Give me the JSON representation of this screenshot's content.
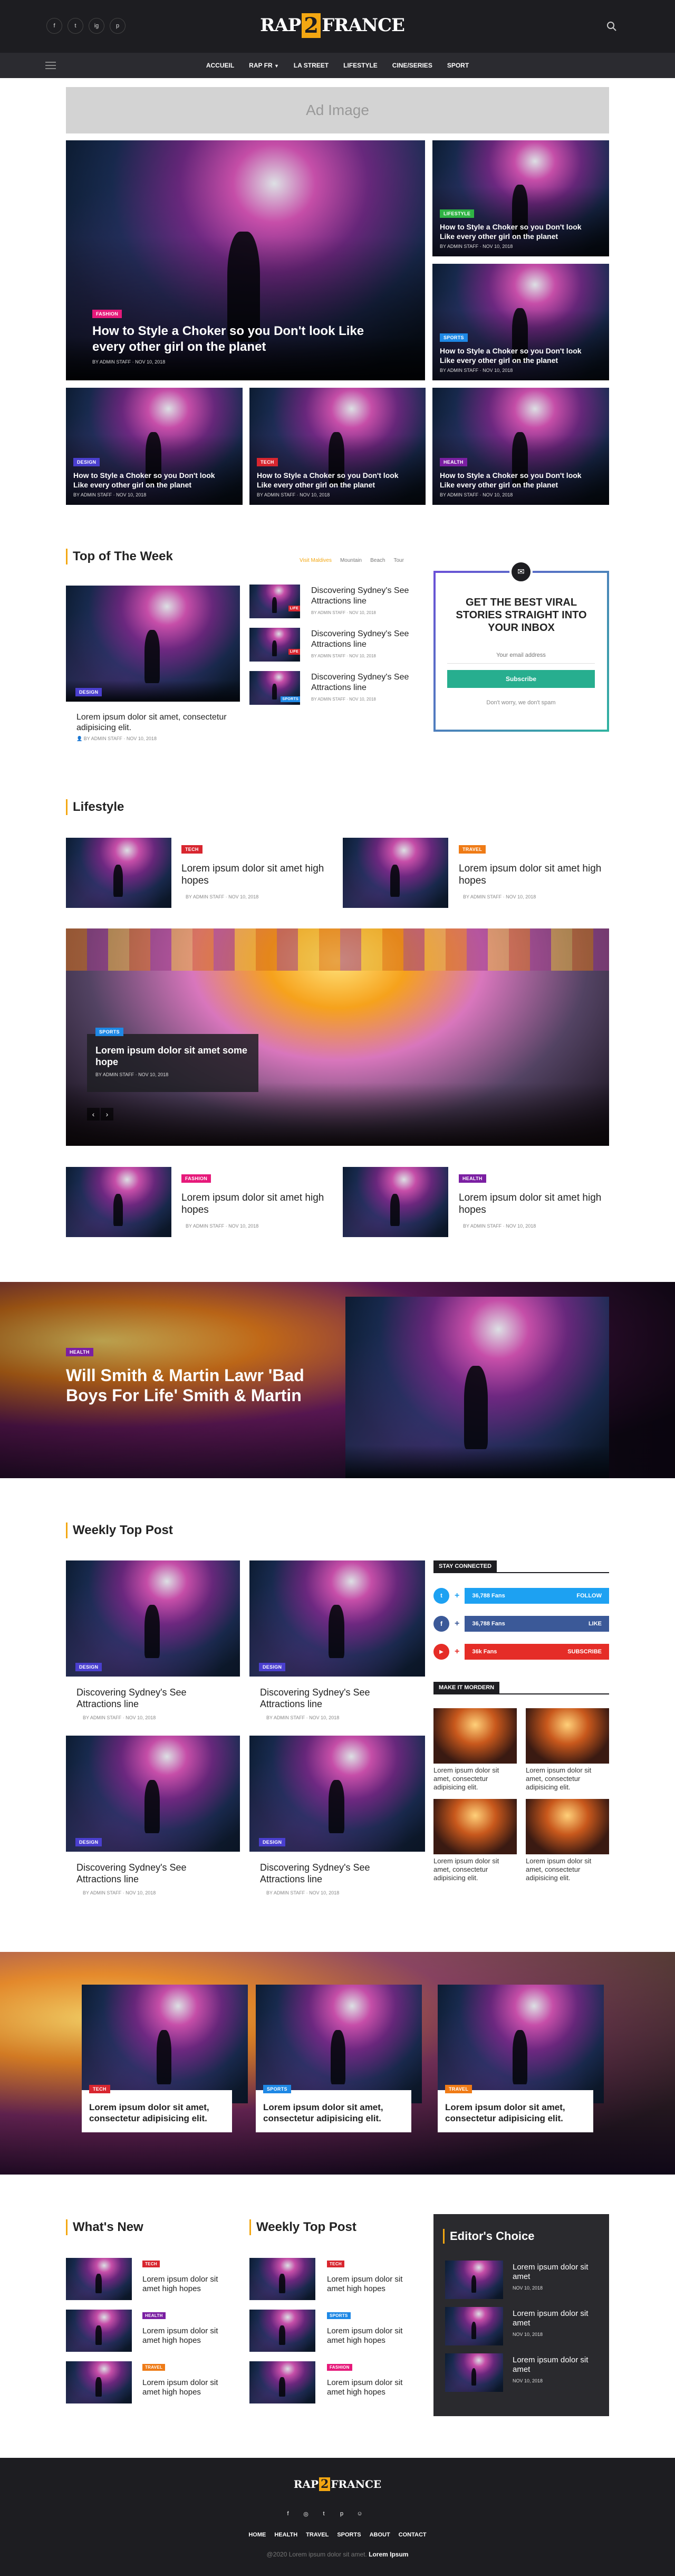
{
  "header": {
    "social": [
      "f",
      "t",
      "ig",
      "p"
    ],
    "logo_top": "RAP",
    "logo_num": "2",
    "logo_bottom": "FRANCE",
    "search_icon": "search-icon"
  },
  "nav": {
    "items": [
      "ACCUEIL",
      "RAP FR",
      "LA STREET",
      "LIFESTYLE",
      "CINE/SERIES",
      "SPORT"
    ],
    "dropdown_item": "RAP FR"
  },
  "ad": {
    "label": "Ad Image"
  },
  "hero": {
    "main": {
      "tag": "FASHION",
      "title": "How to Style a Choker so you Don't look Like every other girl on the planet",
      "meta": "BY ADMIN STAFF · NOV 10, 2018"
    },
    "side": [
      {
        "tag": "LIFESTYLE",
        "title": "How to Style a Choker so you Don't look Like every other girl on the planet",
        "meta": "BY ADMIN STAFF · NOV 10, 2018"
      },
      {
        "tag": "SPORTS",
        "title": "How to Style a Choker so you Don't look Like every other girl on the planet",
        "meta": "BY ADMIN STAFF · NOV 10, 2018"
      }
    ],
    "row": [
      {
        "tag": "DESIGN",
        "title": "How to Style a Choker so you Don't look Like every other girl on the planet",
        "meta": "BY ADMIN STAFF · NOV 10, 2018"
      },
      {
        "tag": "TECH",
        "title": "How to Style a Choker so you Don't look Like every other girl on the planet",
        "meta": "BY ADMIN STAFF · NOV 10, 2018"
      },
      {
        "tag": "HEALTH",
        "title": "How to Style a Choker so you Don't look Like every other girl on the planet",
        "meta": "BY ADMIN STAFF · NOV 10, 2018"
      }
    ]
  },
  "top_week": {
    "title": "Top of The Week",
    "filters": [
      "Visit Maldives",
      "Mountain",
      "Beach",
      "Tour"
    ],
    "main": {
      "tag": "DESIGN",
      "title": "Lorem ipsum dolor sit amet, consectetur adipisicing elit.",
      "meta": "BY ADMIN STAFF · NOV 10, 2018"
    },
    "list": [
      {
        "tag": "LIFE",
        "title": "Discovering Sydney's See Attractions line",
        "meta": "BY ADMIN STAFF · NOV 10, 2018"
      },
      {
        "tag": "LIFE",
        "title": "Discovering Sydney's See Attractions line",
        "meta": "BY ADMIN STAFF · NOV 10, 2018"
      },
      {
        "tag": "SPORTS",
        "title": "Discovering Sydney's See Attractions line",
        "meta": "BY ADMIN STAFF · NOV 10, 2018"
      }
    ]
  },
  "newsletter": {
    "title": "GET THE BEST VIRAL STORIES STRAIGHT INTO YOUR INBOX",
    "placeholder": "Your email address",
    "button": "Subscribe",
    "note": "Don't worry, we don't spam"
  },
  "lifestyle": {
    "title": "Lifestyle",
    "row1": [
      {
        "tag": "TECH",
        "title": "Lorem ipsum dolor sit amet high hopes",
        "meta": "BY ADMIN STAFF · NOV 10, 2018"
      },
      {
        "tag": "TRAVEL",
        "title": "Lorem ipsum dolor sit amet high hopes",
        "meta": "BY ADMIN STAFF · NOV 10, 2018"
      }
    ],
    "slider": {
      "tag": "SPORTS",
      "title": "Lorem ipsum dolor sit amet some hope",
      "meta": "BY ADMIN STAFF · NOV 10, 2018",
      "prev": "‹",
      "next": "›"
    },
    "row2": [
      {
        "tag": "FASHION",
        "title": "Lorem ipsum dolor sit amet high hopes",
        "meta": "BY ADMIN STAFF · NOV 10, 2018"
      },
      {
        "tag": "HEALTH",
        "title": "Lorem ipsum dolor sit amet high hopes",
        "meta": "BY ADMIN STAFF · NOV 10, 2018"
      }
    ]
  },
  "banner": {
    "tag": "HEALTH",
    "title": "Will Smith & Martin Lawr 'Bad Boys For Life' Smith & Martin"
  },
  "weekly": {
    "title": "Weekly Top Post",
    "items": [
      {
        "tag": "DESIGN",
        "title": "Discovering Sydney's See Attractions line",
        "meta": "BY ADMIN STAFF · NOV 10, 2018"
      },
      {
        "tag": "DESIGN",
        "title": "Discovering Sydney's See Attractions line",
        "meta": "BY ADMIN STAFF · NOV 10, 2018"
      },
      {
        "tag": "DESIGN",
        "title": "Discovering Sydney's See Attractions line",
        "meta": "BY ADMIN STAFF · NOV 10, 2018"
      },
      {
        "tag": "DESIGN",
        "title": "Discovering Sydney's See Attractions line",
        "meta": "BY ADMIN STAFF · NOV 10, 2018"
      }
    ]
  },
  "stay": {
    "title": "STAY CONNECTED",
    "rows": [
      {
        "count": "36,788 Fans",
        "action": "FOLLOW",
        "icon": "twitter-icon"
      },
      {
        "count": "36,788 Fans",
        "action": "LIKE",
        "icon": "facebook-icon"
      },
      {
        "count": "36k Fans",
        "action": "SUBSCRIBE",
        "icon": "youtube-icon"
      }
    ]
  },
  "modern": {
    "title": "MAKE IT MORDERN",
    "items": [
      "Lorem ipsum dolor sit amet, consectetur adipisicing elit.",
      "Lorem ipsum dolor sit amet, consectetur adipisicing elit.",
      "Lorem ipsum dolor sit amet, consectetur adipisicing elit.",
      "Lorem ipsum dolor sit amet, consectetur adipisicing elit."
    ]
  },
  "cards_band": [
    {
      "tag": "TECH",
      "title": "Lorem ipsum dolor sit amet, consectetur adipisicing elit."
    },
    {
      "tag": "SPORTS",
      "title": "Lorem ipsum dolor sit amet, consectetur adipisicing elit."
    },
    {
      "tag": "TRAVEL",
      "title": "Lorem ipsum dolor sit amet, consectetur adipisicing elit."
    }
  ],
  "whats_new": {
    "title": "What's New",
    "items": [
      {
        "tag": "TECH",
        "title": "Lorem ipsum dolor sit amet high hopes"
      },
      {
        "tag": "HEALTH",
        "title": "Lorem ipsum dolor sit amet high hopes"
      },
      {
        "tag": "TRAVEL",
        "title": "Lorem ipsum dolor sit amet high hopes"
      }
    ]
  },
  "weekly2": {
    "title": "Weekly Top Post",
    "items": [
      {
        "tag": "TECH",
        "title": "Lorem ipsum dolor sit amet high hopes"
      },
      {
        "tag": "SPORTS",
        "title": "Lorem ipsum dolor sit amet high hopes"
      },
      {
        "tag": "FASHION",
        "title": "Lorem ipsum dolor sit amet high hopes"
      }
    ]
  },
  "editors": {
    "title": "Editor's Choice",
    "items": [
      {
        "title": "Lorem ipsum dolor sit amet",
        "date": "NOV 10, 2018"
      },
      {
        "title": "Lorem ipsum dolor sit amet",
        "date": "NOV 10, 2018"
      },
      {
        "title": "Lorem ipsum dolor sit amet",
        "date": "NOV 10, 2018"
      }
    ]
  },
  "footer": {
    "links": [
      "HOME",
      "HEALTH",
      "TRAVEL",
      "SPORTS",
      "ABOUT",
      "CONTACT"
    ],
    "copy": "@2020 Lorem ipsum dolor sit amet.",
    "brand": "Lorem Ipsum"
  },
  "colors": {
    "accent": "#f3a712",
    "dark": "#1f1f23",
    "nav": "#2b2b30"
  }
}
